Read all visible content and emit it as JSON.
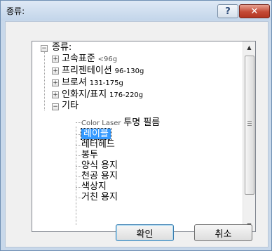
{
  "window": {
    "title": "종류:",
    "help_label": "?",
    "close_label": "✕"
  },
  "tree": {
    "root": {
      "label": "종류:",
      "expander": "⊟"
    },
    "groups": [
      {
        "name": "고속표준",
        "detail": "<96g",
        "expander": "+"
      },
      {
        "name": "프리젠테이션",
        "detail": "96-130g",
        "expander": "+"
      },
      {
        "name": "브로셔",
        "detail": "131-175g",
        "expander": "+"
      },
      {
        "name": "인화지/표지",
        "detail": "176-220g",
        "expander": "+"
      },
      {
        "name": "기타",
        "detail": "",
        "expander": "−"
      }
    ],
    "other_items": [
      {
        "prefix": "Color Laser",
        "label": "투명 필름",
        "selected": false
      },
      {
        "prefix": "",
        "label": "레이블",
        "selected": true
      },
      {
        "prefix": "",
        "label": "레터헤드",
        "selected": false
      },
      {
        "prefix": "",
        "label": "봉투",
        "selected": false
      },
      {
        "prefix": "",
        "label": "양식 용지",
        "selected": false
      },
      {
        "prefix": "",
        "label": "천공 용지",
        "selected": false
      },
      {
        "prefix": "",
        "label": "색상지",
        "selected": false
      },
      {
        "prefix": "",
        "label": "거친 용지",
        "selected": false
      }
    ]
  },
  "scrollbar": {
    "up_icon": "▲",
    "down_icon": "▼",
    "position_fraction": 0.1
  },
  "buttons": {
    "ok_label": "확인",
    "cancel_label": "취소"
  }
}
